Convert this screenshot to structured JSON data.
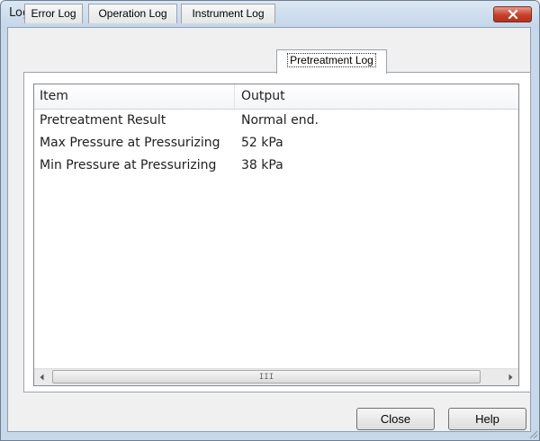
{
  "window": {
    "title": "Logs"
  },
  "tabs": [
    {
      "label": "Error Log"
    },
    {
      "label": "Operation Log"
    },
    {
      "label": "Instrument Log"
    },
    {
      "label": "Pretreatment Log"
    }
  ],
  "active_tab": "Pretreatment Log",
  "table": {
    "columns": [
      "Item",
      "Output"
    ],
    "rows": [
      {
        "item": "Pretreatment Result",
        "output": "Normal end."
      },
      {
        "item": "Max Pressure at Pressurizing",
        "output": "52 kPa"
      },
      {
        "item": "Min Pressure at Pressurizing",
        "output": "38 kPa"
      }
    ],
    "scrollbar_grip": "III"
  },
  "buttons": {
    "close": "Close",
    "help": "Help"
  },
  "colors": {
    "title_close_red": "#c7402a",
    "titlebar": "#c4d6e9"
  }
}
